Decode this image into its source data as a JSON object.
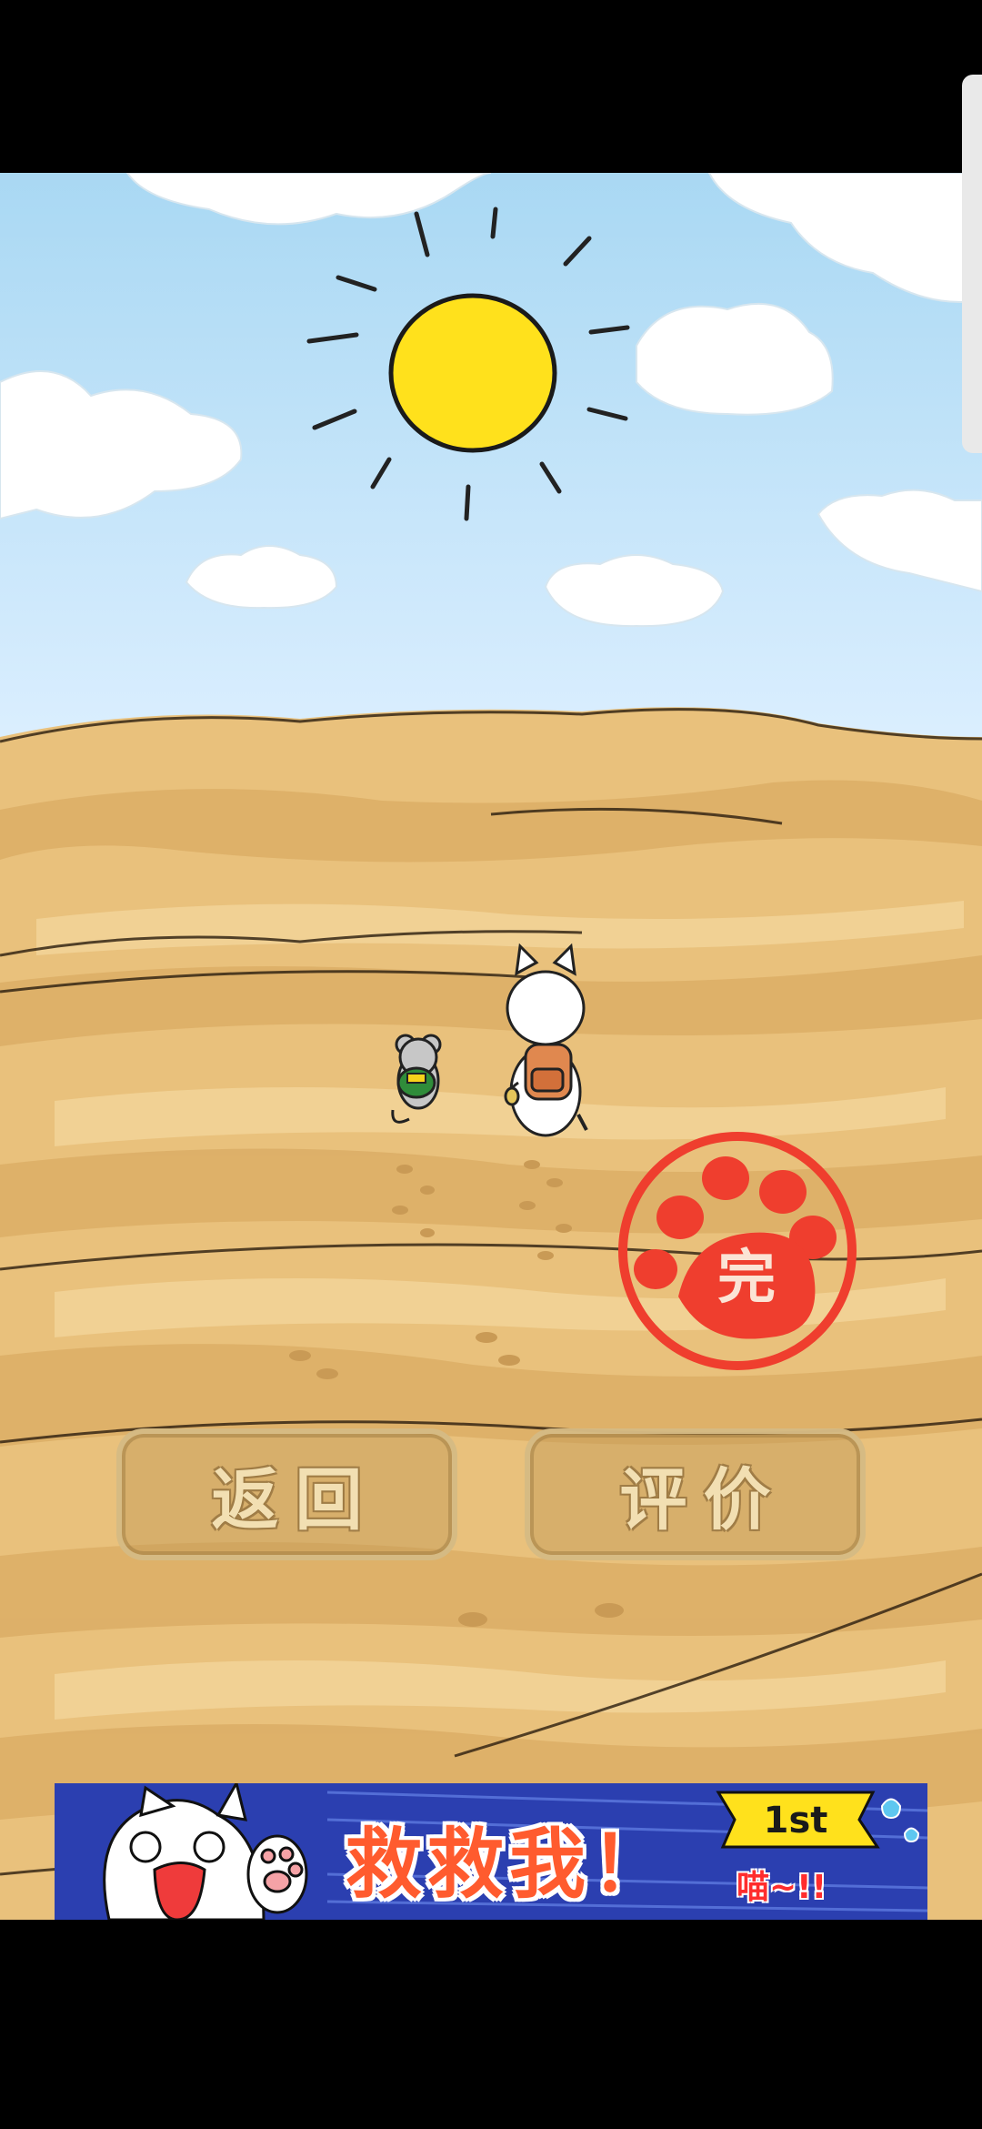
{
  "buttons": {
    "back_label": "返回",
    "rate_label": "评价"
  },
  "stamp": {
    "label": "完"
  },
  "banner": {
    "title": "救救我！",
    "badge": "1st",
    "subtitle": "喵~!!"
  },
  "colors": {
    "sky": "#bfe0f2",
    "sand": "#e8c07c",
    "sun": "#ffe11c",
    "stamp": "#ef3e2e"
  }
}
